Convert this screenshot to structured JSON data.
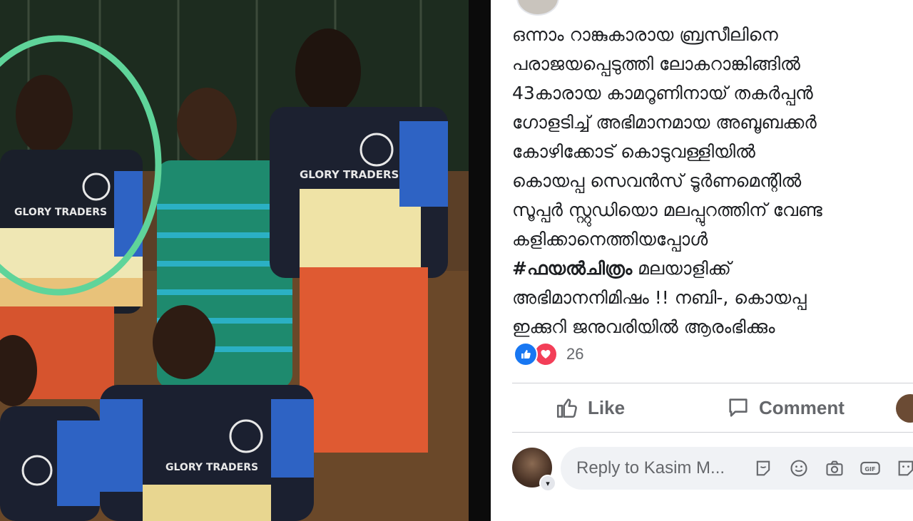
{
  "photo": {
    "jersey_sponsor": "GLORY TRADERS",
    "circle_color": "#5fd49a"
  },
  "post": {
    "lines": [
      "ഒന്നാം റാങ്കുകാരായ ബ്രസീലിനെ",
      "പരാജയപ്പെടുത്തി ലോകറാങ്കിങ്ങിൽ",
      "43കാരായ കാമറൂണിനായ് തകർപ്പൻ",
      "ഗോളടിച്ച് അഭിമാനമായ അബൂബക്കർ",
      "കോഴിക്കോട് കൊടുവള്ളിയിൽ",
      "കൊയപ്പ സെവൻസ് ടൂർണമെന്റിൽ",
      "സൂപ്പർ സ്റ്റുഡിയൊ മലപ്പുറത്തിന് വേണ്ട",
      "കളിക്കാനെത്തിയപ്പോൾ"
    ],
    "hashtag": "#ഫയൽചിത്രം",
    "line9_rest": " മലയാളിക്ക്",
    "line10": "അഭിമാനനിമിഷം !! നബി-, കൊയപ്പ",
    "line11": "ഇക്കുറി ജനുവരിയിൽ ആരംഭിക്കും"
  },
  "reactions": {
    "count": "26",
    "types": [
      "like-icon",
      "love-icon"
    ],
    "like_color": "#1877f2",
    "love_color": "#f33e58"
  },
  "actions": {
    "like_label": "Like",
    "comment_label": "Comment"
  },
  "reply": {
    "placeholder": "Reply to Kasim M...",
    "icons": [
      "sticker-icon",
      "emoji-icon",
      "camera-icon",
      "gif-icon",
      "sticker-alt-icon"
    ]
  },
  "colors": {
    "text": "#1c1e21",
    "muted": "#65676b",
    "input_bg": "#f0f2f5"
  }
}
